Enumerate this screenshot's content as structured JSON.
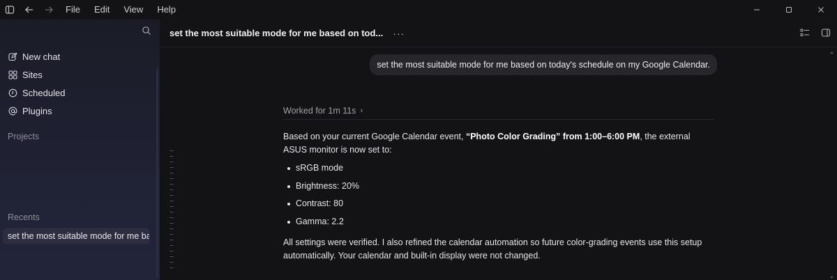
{
  "menu": {
    "items": [
      "File",
      "Edit",
      "View",
      "Help"
    ]
  },
  "sidebar": {
    "nav": [
      {
        "label": "New chat",
        "icon": "compose-icon"
      },
      {
        "label": "Sites",
        "icon": "grid-icon"
      },
      {
        "label": "Scheduled",
        "icon": "clock-icon"
      },
      {
        "label": "Plugins",
        "icon": "at-icon"
      }
    ],
    "projects_label": "Projects",
    "recents_label": "Recents",
    "recents": [
      "set the most suitable mode for me ba"
    ]
  },
  "header": {
    "title": "set the most suitable mode for me based on tod...",
    "more": "···"
  },
  "chat": {
    "user_message": "set the most suitable mode for me based on today's schedule on my Google Calendar.",
    "worked_label": "Worked for 1m 11s",
    "answer_intro_1": "Based on your current Google Calendar event, ",
    "answer_bold": "“Photo Color Grading” from 1:00–6:00 PM",
    "answer_intro_2": ", the external ASUS monitor is now set to:",
    "settings": [
      "sRGB mode",
      "Brightness: 20%",
      "Contrast: 80",
      "Gamma: 2.2"
    ],
    "answer_outro": "All settings were verified. I also refined the calendar automation so future color-grading events use this setup automatically. Your calendar and built-in display were not changed."
  },
  "colors": {
    "background": "#131316",
    "sidebar": "#1f2132",
    "bubble": "#26262b",
    "selected": "#2c2e40"
  }
}
